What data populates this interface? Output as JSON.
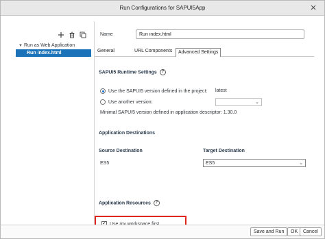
{
  "window": {
    "title": "Run Configurations for SAPUI5App"
  },
  "toolbar": {
    "icons": [
      "add-icon",
      "delete-icon",
      "duplicate-icon"
    ]
  },
  "tree": {
    "group_label": "Run as Web Application",
    "selected_label": "Run index.html"
  },
  "form": {
    "name_label": "Name",
    "name_value": "Run index.html"
  },
  "tabs": [
    "General",
    "URL Components",
    "Advanced Settings"
  ],
  "active_tab": "Advanced Settings",
  "runtime": {
    "title": "SAPUI5 Runtime Settings",
    "option_project_label": "Use the SAPUI5 version defined in the project:",
    "option_project_value": "latest",
    "option_other_label": "Use another version:",
    "minimal_version_text": "Minimal SAPUI5 version defined in application descriptor: 1.30.0"
  },
  "destinations": {
    "title": "Application Destinations",
    "source_header": "Source Destination",
    "target_header": "Target Destination",
    "source_value": "ES5",
    "target_value": "ES5"
  },
  "resources": {
    "title": "Application Resources",
    "workspace_checkbox_label": "Use my workspace first",
    "workspace_checked": true
  },
  "buttons": {
    "save_and_run": "Save and Run",
    "ok": "OK",
    "cancel": "Cancel"
  },
  "colors": {
    "selection": "#1a73b8",
    "highlight_border": "#e0271f"
  }
}
